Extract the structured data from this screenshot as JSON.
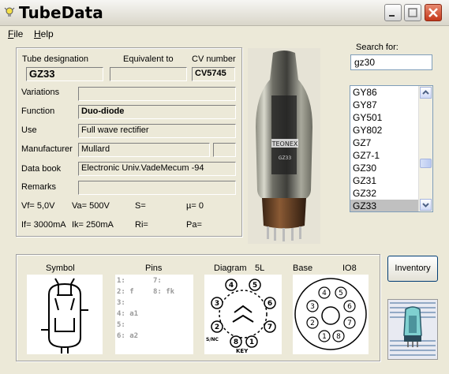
{
  "window": {
    "title": "TubeData"
  },
  "menu": [
    "File",
    "Help"
  ],
  "tube": {
    "designation_label": "Tube designation",
    "designation": "GZ33",
    "equivalent_label": "Equivalent to",
    "equivalent": "",
    "cv_label": "CV number",
    "cv": "CV5745",
    "variations_label": "Variations",
    "variations": "",
    "function_label": "Function",
    "function": "Duo-diode",
    "use_label": "Use",
    "use": "Full wave rectifier",
    "manufacturer_label": "Manufacturer",
    "manufacturer": "Mullard",
    "manufacturer_extra": "",
    "databook_label": "Data book",
    "databook": "Electronic Univ.VadeMecum -94",
    "remarks_label": "Remarks",
    "remarks": ""
  },
  "params": {
    "vf": "Vf= 5,0V",
    "va": "Va= 500V",
    "s": "S=",
    "mu": "µ=    0",
    "if": "If= 3000mA",
    "ik": "Ik=   250mA",
    "ri": "Ri=",
    "pa": "Pa="
  },
  "photo": {
    "brand": "TEONEX",
    "model": "GZ33"
  },
  "search": {
    "label": "Search for:",
    "value": "gz30"
  },
  "list": {
    "items": [
      "GY86",
      "GY87",
      "GY501",
      "GY802",
      "GZ7",
      "GZ7-1",
      "GZ30",
      "GZ31",
      "GZ32",
      "GZ33"
    ],
    "selected": "GZ33"
  },
  "bottom": {
    "symbol_label": "Symbol",
    "pins_label": "Pins",
    "diagram_label": "Diagram",
    "diagram_code": "5L",
    "base_label": "Base",
    "base_code": "IO8",
    "pins": [
      "1:",
      "2: f",
      "3:",
      "4: a1",
      "5:",
      "6: a2",
      "7:",
      "8: fk"
    ],
    "diagram_pins": [
      "1",
      "2",
      "3",
      "4",
      "5",
      "6",
      "7",
      "8"
    ],
    "diagram_note": "S/NC",
    "diagram_key": "KEY",
    "base_pins": [
      "1",
      "2",
      "3",
      "4",
      "5",
      "6",
      "7",
      "8"
    ]
  },
  "inventory": {
    "label": "Inventory"
  }
}
